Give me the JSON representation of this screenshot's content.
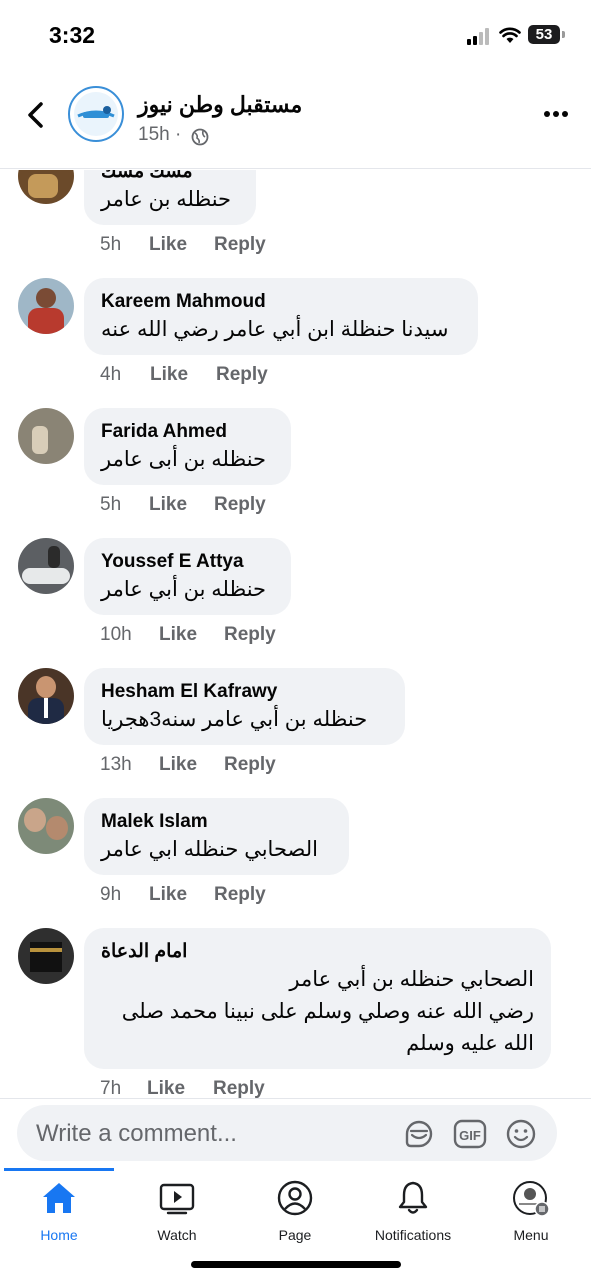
{
  "status": {
    "time": "3:32",
    "battery": "53"
  },
  "header": {
    "page_name": "مستقبل وطن نيوز",
    "post_time": "15h ·"
  },
  "comments": [
    {
      "name": "مسك مسك",
      "text": "حنظله بن عامر",
      "time": "5h",
      "like": "Like",
      "reply": "Reply"
    },
    {
      "name": "Kareem Mahmoud",
      "text": "سيدنا حنظلة ابن أبي عامر رضي الله عنه",
      "time": "4h",
      "like": "Like",
      "reply": "Reply"
    },
    {
      "name": "Farida Ahmed",
      "text": "حنظله بن أبى عامر",
      "time": "5h",
      "like": "Like",
      "reply": "Reply"
    },
    {
      "name": "Youssef E Attya",
      "text": "حنظله بن أبي عامر",
      "time": "10h",
      "like": "Like",
      "reply": "Reply"
    },
    {
      "name": "Hesham El Kafrawy",
      "text": "حنظله بن أبي عامر سنه3هجريا",
      "time": "13h",
      "like": "Like",
      "reply": "Reply"
    },
    {
      "name": "Malek Islam",
      "text": "الصحابي حنظله ابي عامر",
      "time": "9h",
      "like": "Like",
      "reply": "Reply"
    },
    {
      "name": "امام الدعاة",
      "lines": [
        "الصحابي حنظله بن أبي عامر",
        "رضي الله عنه وصلي وسلم على نبينا محمد صلى",
        "الله عليه وسلم"
      ],
      "time": "7h",
      "like": "Like",
      "reply": "Reply"
    }
  ],
  "composer": {
    "placeholder": "Write a comment..."
  },
  "tabs": [
    {
      "label": "Home",
      "icon": "home-icon",
      "active": true
    },
    {
      "label": "Watch",
      "icon": "watch-icon"
    },
    {
      "label": "Page",
      "icon": "page-icon"
    },
    {
      "label": "Notifications",
      "icon": "bell-icon"
    },
    {
      "label": "Menu",
      "icon": "menu-avatar-icon"
    }
  ],
  "colors": {
    "accent": "#1877f2",
    "bubble": "#f0f2f5",
    "meta": "#65676b"
  }
}
